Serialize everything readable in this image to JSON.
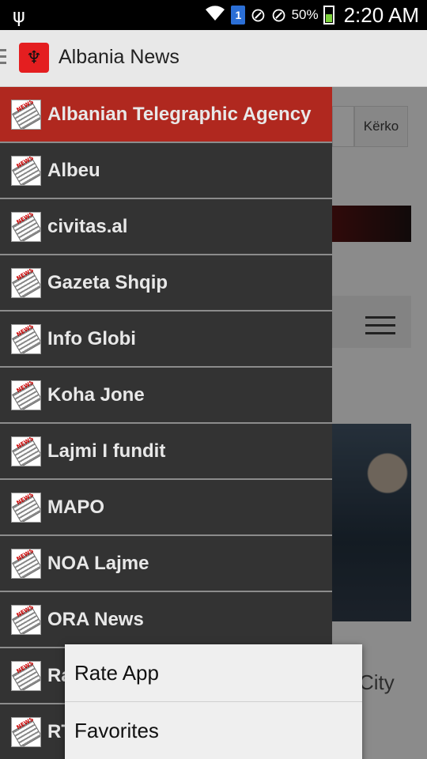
{
  "status_bar": {
    "usb_icon": "usb-icon",
    "sim_label": "1",
    "battery_percent": "50%",
    "battery_level": 0.5,
    "time": "2:20 AM"
  },
  "app_bar": {
    "title": "Albania News",
    "logo_icon": "albania-flag-icon"
  },
  "background": {
    "search_button": "Kërko",
    "headline_fragment": "City"
  },
  "drawer": {
    "items": [
      {
        "label": "Albanian Telegraphic Agency",
        "active": true
      },
      {
        "label": "Albeu"
      },
      {
        "label": "civitas.al"
      },
      {
        "label": "Gazeta Shqip"
      },
      {
        "label": "Info Globi"
      },
      {
        "label": "Koha Jone"
      },
      {
        "label": "Lajmi I fundit"
      },
      {
        "label": "MAPO"
      },
      {
        "label": "NOA Lajme"
      },
      {
        "label": "ORA News"
      },
      {
        "label": "Ra"
      },
      {
        "label": "RT"
      }
    ],
    "item_icon": "newspaper-icon"
  },
  "popup_menu": {
    "items": [
      {
        "label": "Rate App"
      },
      {
        "label": "Favorites"
      }
    ]
  },
  "colors": {
    "active_item": "#b0281f",
    "drawer_bg": "#333333",
    "app_bar_bg": "#e8e8e8"
  }
}
